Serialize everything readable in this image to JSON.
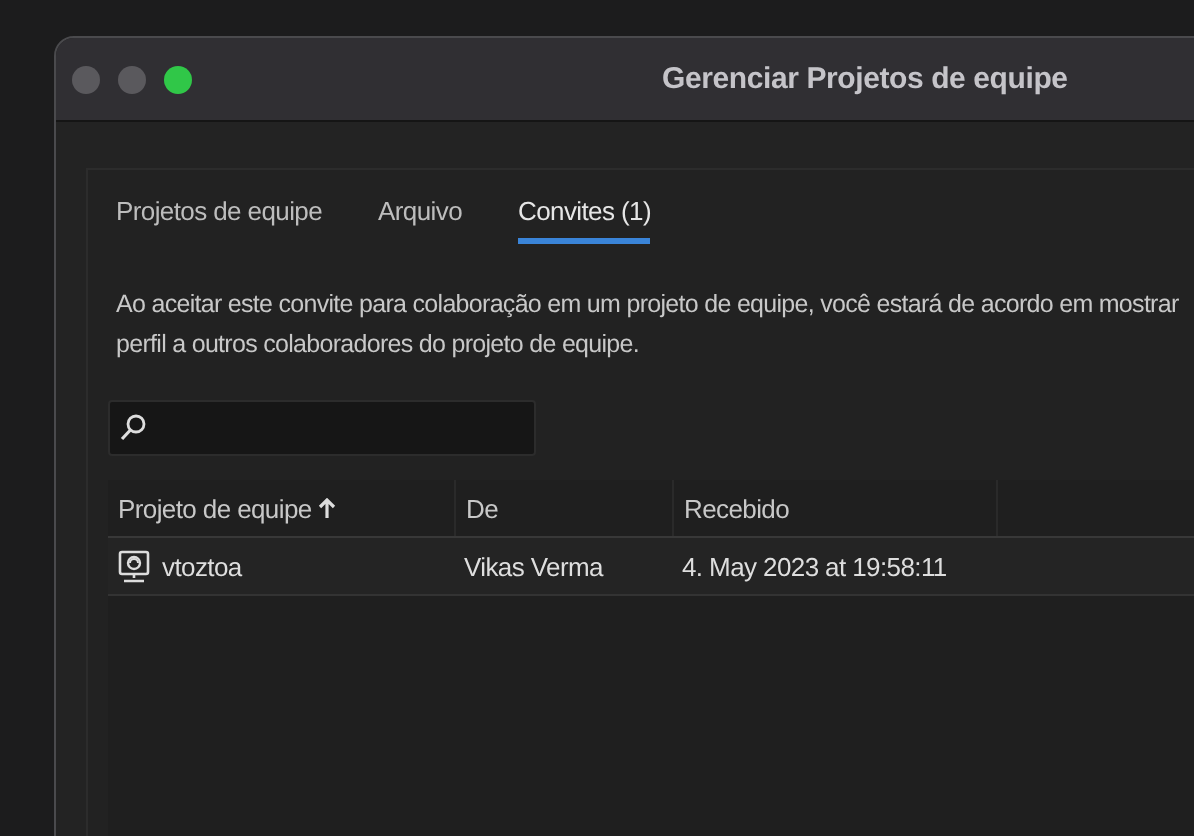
{
  "window": {
    "title": "Gerenciar Projetos de equipe"
  },
  "tabs": [
    {
      "label": "Projetos de equipe",
      "selected": false
    },
    {
      "label": "Arquivo",
      "selected": false
    },
    {
      "label": "Convites (1)",
      "selected": true
    }
  ],
  "notice": [
    "Ao aceitar este convite para colaboração em um projeto de equipe, você estará de acordo em mostrar",
    "perfil a outros colaboradores do projeto de equipe."
  ],
  "table": {
    "columns": [
      {
        "label": "Projeto de equipe",
        "sorted": true
      },
      {
        "label": "De",
        "sorted": false
      },
      {
        "label": "Recebido",
        "sorted": false
      }
    ],
    "rows": [
      {
        "project": "vtoztoa",
        "from": "Vikas Verma",
        "received": "4. May 2023 at 19:58:11"
      }
    ]
  }
}
